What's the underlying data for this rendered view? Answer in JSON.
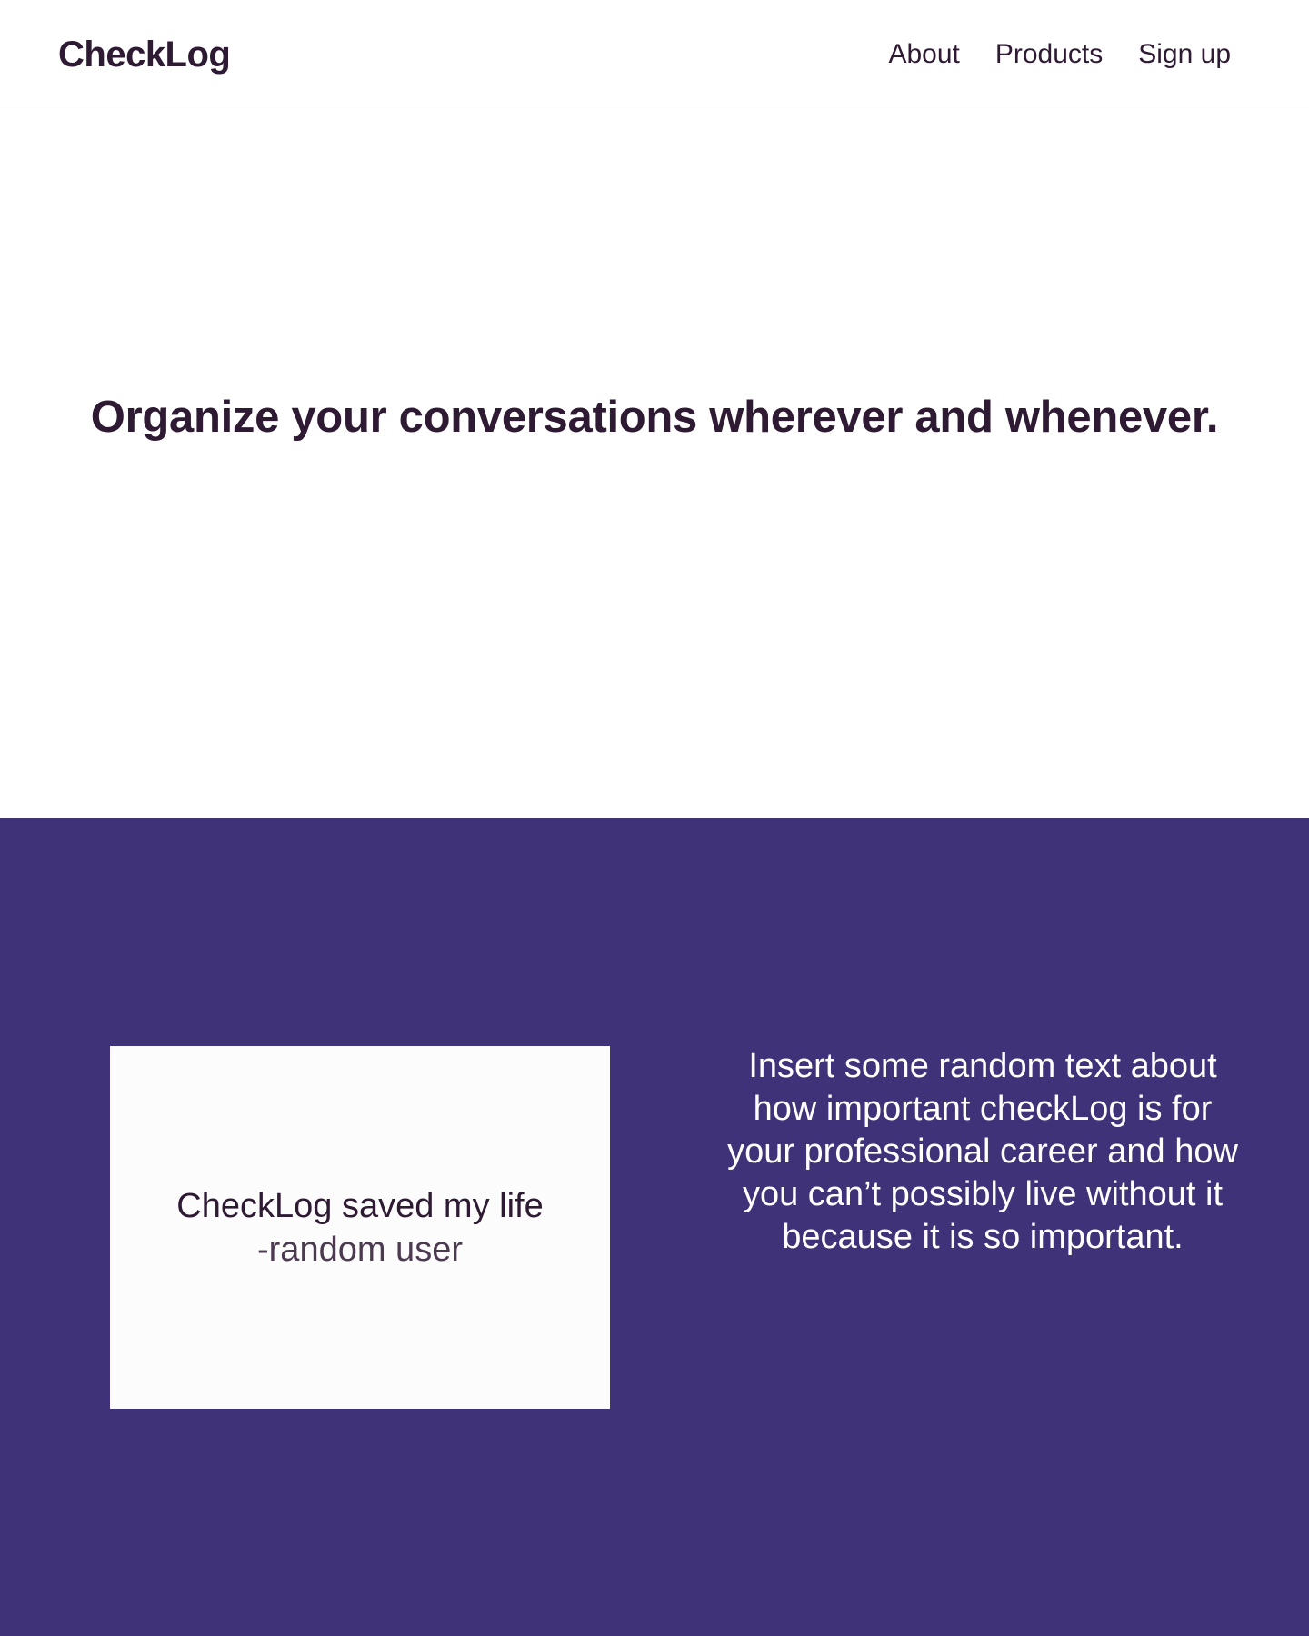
{
  "header": {
    "brand": "CheckLog",
    "nav": [
      {
        "label": "About"
      },
      {
        "label": "Products"
      },
      {
        "label": "Sign up"
      }
    ]
  },
  "hero": {
    "title": "Organize your conversations wherever and whenever."
  },
  "feature": {
    "testimonial": {
      "quote": "CheckLog saved my life",
      "author": "-random user"
    },
    "description": "Insert some random text about how important checkLog is for your professional career and how you can’t possibly live without it because it is so important."
  },
  "colors": {
    "text": "#2e1a33",
    "feature_background": "#403278",
    "card_background": "#fdfcfd",
    "header_border": "#d6ece9"
  }
}
